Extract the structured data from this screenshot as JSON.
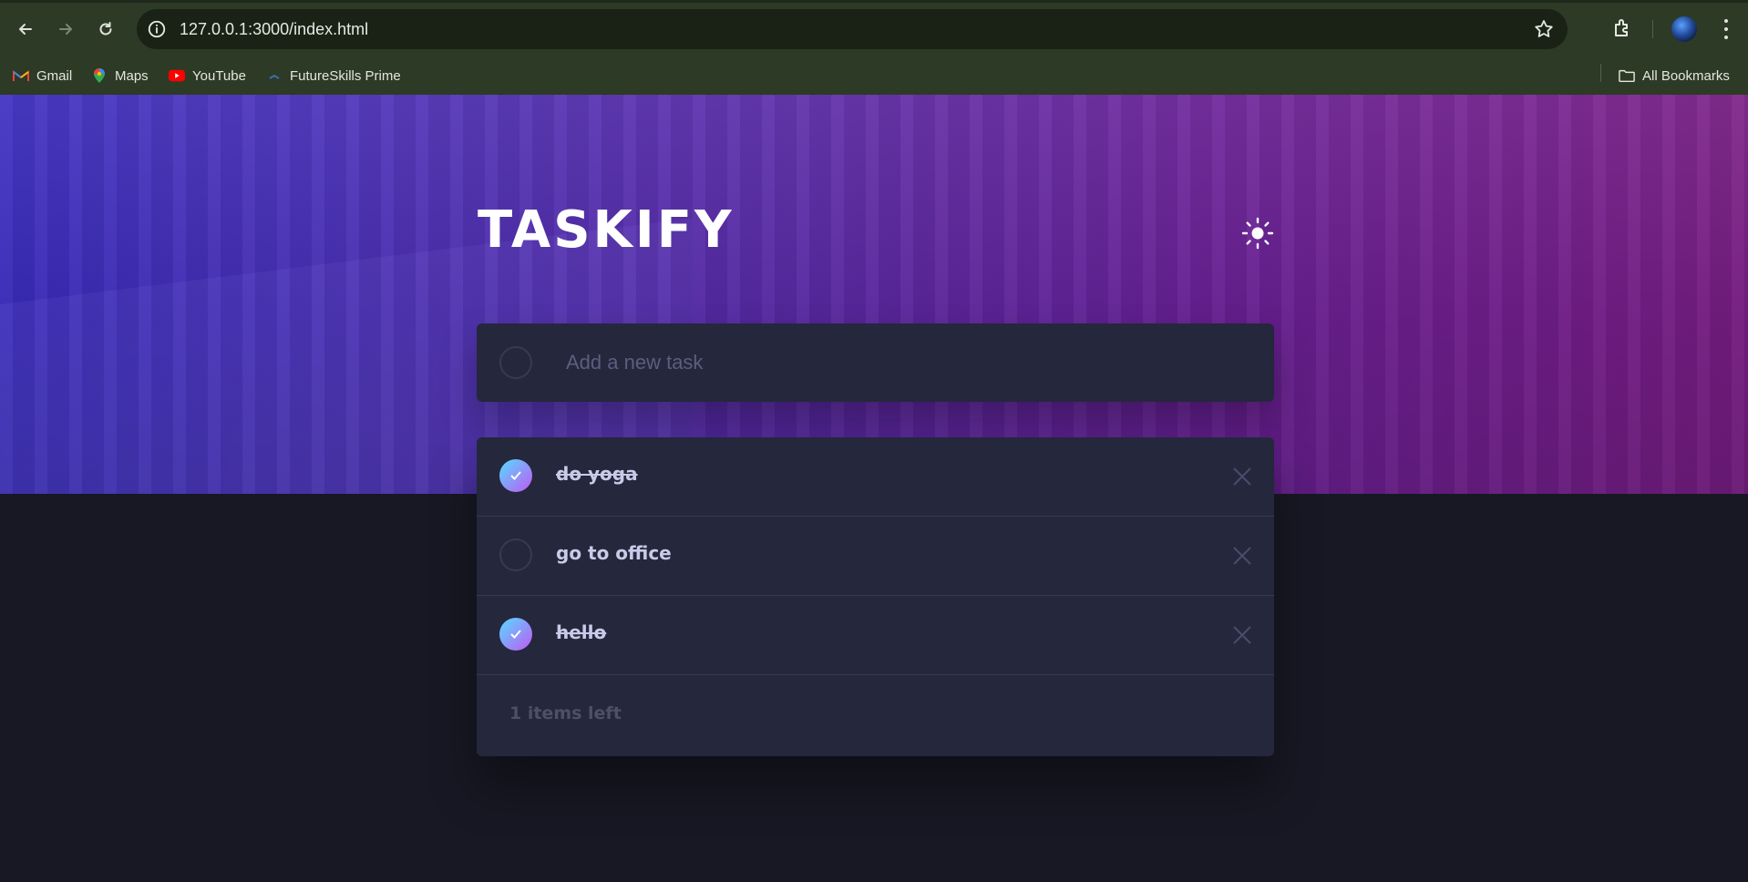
{
  "browser": {
    "url": "127.0.0.1:3000/index.html",
    "bookmarks": [
      {
        "label": "Gmail",
        "icon": "gmail-icon"
      },
      {
        "label": "Maps",
        "icon": "maps-icon"
      },
      {
        "label": "YouTube",
        "icon": "youtube-icon"
      },
      {
        "label": "FutureSkills Prime",
        "icon": "futureskills-icon"
      }
    ],
    "all_bookmarks": "All Bookmarks"
  },
  "app": {
    "title": "TASKIFY",
    "new_task_placeholder": "Add a new task",
    "todos": [
      {
        "text": "do yoga",
        "completed": true
      },
      {
        "text": "go to office",
        "completed": false
      },
      {
        "text": "hello",
        "completed": true
      }
    ],
    "items_left": "1 items left"
  },
  "colors": {
    "page_bg": "#171823",
    "card_bg": "#25273d",
    "check_gradient_start": "#55ddff",
    "check_gradient_end": "#c058f3",
    "browser_chrome": "#2d3a26"
  }
}
